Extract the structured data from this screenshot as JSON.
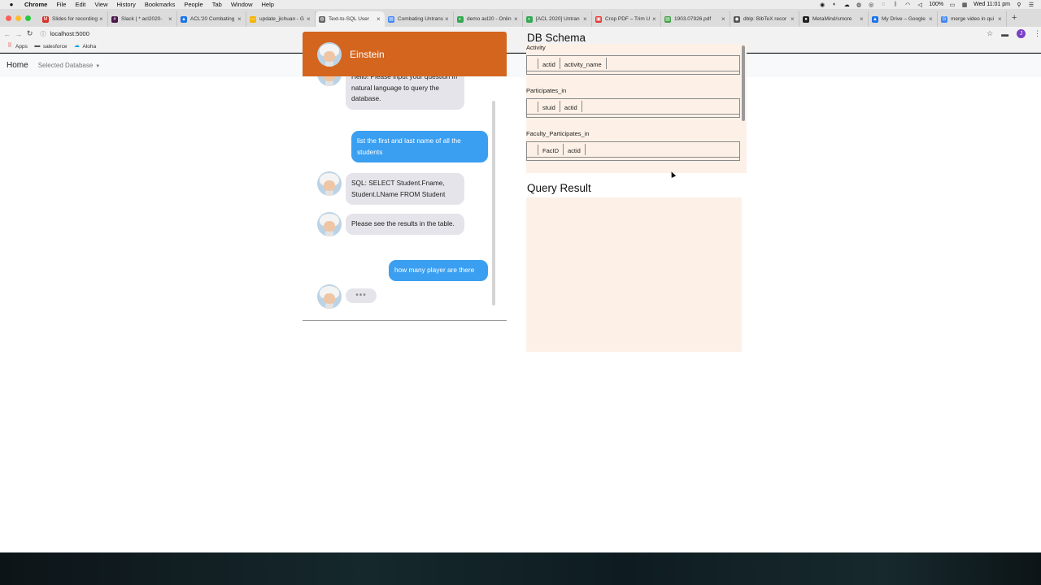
{
  "menubar": {
    "app": "Chrome",
    "items": [
      "File",
      "Edit",
      "View",
      "History",
      "Bookmarks",
      "People",
      "Tab",
      "Window",
      "Help"
    ],
    "battery": "100%",
    "clock": "Wed 11:01 pm"
  },
  "tabs": [
    {
      "title": "Slides for recording",
      "color": "#d93025",
      "glyph": "M"
    },
    {
      "title": "Slack | * acl2020-",
      "color": "#4a154b",
      "glyph": "#"
    },
    {
      "title": "ACL'20 Combating",
      "color": "#1a73e8",
      "glyph": "▲"
    },
    {
      "title": "update_jichuan - G",
      "color": "#f4b400",
      "glyph": "▭"
    },
    {
      "title": "Text-to-SQL User",
      "color": "#666666",
      "glyph": "◍",
      "active": true
    },
    {
      "title": "Combating Untrans",
      "color": "#4285f4",
      "glyph": "▤"
    },
    {
      "title": "demo acl20 - Onlin",
      "color": "#34a853",
      "glyph": "◐"
    },
    {
      "title": "[ACL 2020] Untran",
      "color": "#34a853",
      "glyph": "◐"
    },
    {
      "title": "Crop PDF – Trim U",
      "color": "#e53935",
      "glyph": "▣"
    },
    {
      "title": "1903.07926.pdf",
      "color": "#43a047",
      "glyph": "▤"
    },
    {
      "title": "dblp: BibTeX recor",
      "color": "#555555",
      "glyph": "◆"
    },
    {
      "title": "MetaMind/smore",
      "color": "#222222",
      "glyph": "●"
    },
    {
      "title": "My Drive – Google",
      "color": "#1a73e8",
      "glyph": "▲"
    },
    {
      "title": "merge video in qui",
      "color": "#4285f4",
      "glyph": "G"
    }
  ],
  "browser": {
    "url": "localhost:5000",
    "profile_initial": "J"
  },
  "bookmarks": [
    {
      "label": "Apps",
      "icon": "apps-grid-icon"
    },
    {
      "label": "salesforce",
      "icon": "folder-icon"
    },
    {
      "label": "Aloha",
      "icon": "cloud-icon"
    }
  ],
  "navbar": {
    "home": "Home",
    "database_dropdown": "Selected Database"
  },
  "chat": {
    "title": "Einstein",
    "messages": [
      {
        "from": "bot",
        "text": "Hello! Please input your question in natural language to query the database."
      },
      {
        "from": "user",
        "text": "list the first and last name of all the students"
      },
      {
        "from": "bot",
        "text": "SQL: SELECT Student.Fname, Student.LName FROM Student"
      },
      {
        "from": "bot",
        "text": "Please see the results in the table."
      },
      {
        "from": "user",
        "text": "how many player are there"
      }
    ],
    "typing": "•••"
  },
  "schema": {
    "heading": "DB Schema",
    "tables": [
      {
        "name": "Activity",
        "columns": [
          "actid",
          "activity_name"
        ]
      },
      {
        "name": "Participates_in",
        "columns": [
          "stuid",
          "actid"
        ]
      },
      {
        "name": "Faculty_Participates_in",
        "columns": [
          "FacID",
          "actid"
        ]
      }
    ]
  },
  "result": {
    "heading": "Query Result"
  },
  "colors": {
    "chat_header": "#d4651f",
    "user_bubble": "#3a9ff1",
    "bot_bubble": "#e5e4ea",
    "panel_bg": "#fdf1e7"
  }
}
